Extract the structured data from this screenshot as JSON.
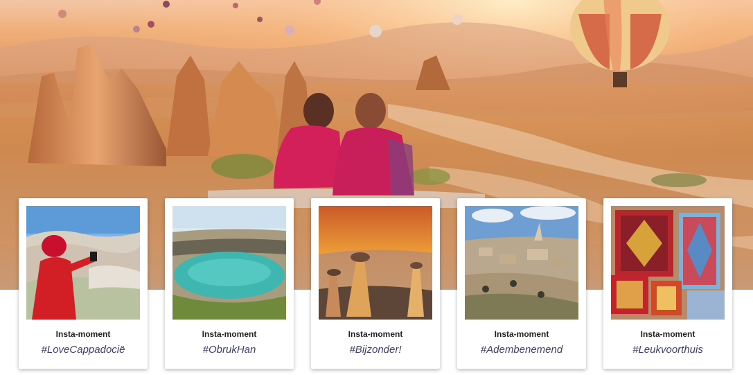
{
  "cards": [
    {
      "title": "Insta-moment",
      "tag": "#LoveCappadociё"
    },
    {
      "title": "Insta-moment",
      "tag": "#ObrukHan"
    },
    {
      "title": "Insta-moment",
      "tag": "#Bijzonder!"
    },
    {
      "title": "Insta-moment",
      "tag": "#Adembenemend"
    },
    {
      "title": "Insta-moment",
      "tag": "#Leukvoorthuis"
    }
  ]
}
